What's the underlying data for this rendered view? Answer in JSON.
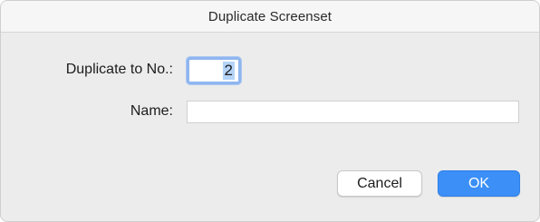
{
  "window": {
    "title": "Duplicate Screenset"
  },
  "form": {
    "number_label": "Duplicate to No.:",
    "number_value": "2",
    "name_label": "Name:",
    "name_value": ""
  },
  "buttons": {
    "cancel_label": "Cancel",
    "ok_label": "OK"
  },
  "colors": {
    "accent": "#3b8ff6",
    "focus_ring": "#8fb6ef",
    "dialog_background": "#ececec"
  }
}
